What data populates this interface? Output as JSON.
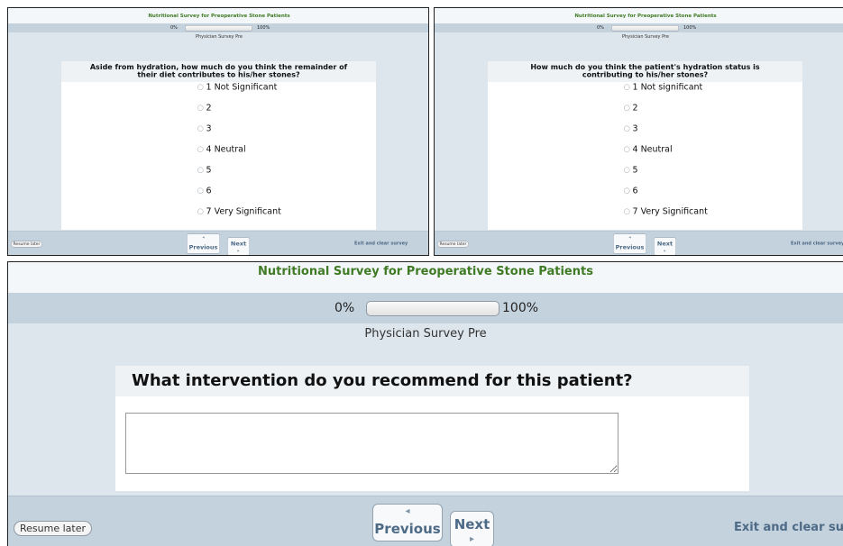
{
  "survey": {
    "title": "Nutritional Survey for Preoperative Stone Patients",
    "progress_start": "0%",
    "progress_end": "100%",
    "progress_value": 0,
    "subtitle": "Physician Survey Pre"
  },
  "buttons": {
    "resume": "Resume later",
    "previous": "Previous",
    "next": "Next",
    "exit": "Exit and clear survey",
    "arrow_left": "◂",
    "arrow_right": "▸"
  },
  "panel_a": {
    "question": "Aside from hydration, how much do you think the remainder of their diet contributes to his/her stones?",
    "options": [
      "1 Not Significant",
      "2",
      "3",
      "4 Neutral",
      "5",
      "6",
      "7 Very Significant"
    ]
  },
  "panel_b": {
    "question": "How much do you think the patient's hydration status is contributing to his/her stones?",
    "options": [
      "1 Not significant",
      "2",
      "3",
      "4 Neutral",
      "5",
      "6",
      "7 Very Significant"
    ]
  },
  "panel_c": {
    "question": "What intervention do you recommend for this patient?",
    "answer": ""
  },
  "colors": {
    "title_green": "#3f7a24",
    "band_blue": "#c4d2de",
    "page_blue": "#dde6ed",
    "link_blue": "#4d6a86"
  }
}
